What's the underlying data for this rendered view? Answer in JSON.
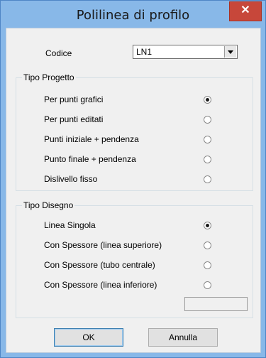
{
  "window": {
    "title": "Polilinea di profilo",
    "close_label": "✕"
  },
  "codice": {
    "label": "Codice",
    "value": "LN1"
  },
  "tipo_progetto": {
    "title": "Tipo Progetto",
    "options": [
      {
        "label": "Per punti grafici",
        "checked": true
      },
      {
        "label": "Per punti editati",
        "checked": false
      },
      {
        "label": "Punti iniziale + pendenza",
        "checked": false
      },
      {
        "label": "Punto finale + pendenza",
        "checked": false
      },
      {
        "label": "Dislivello fisso",
        "checked": false
      }
    ]
  },
  "tipo_disegno": {
    "title": "Tipo Disegno",
    "options": [
      {
        "label": "Linea Singola",
        "checked": true
      },
      {
        "label": "Con Spessore (linea superiore)",
        "checked": false
      },
      {
        "label": "Con Spessore (tubo centrale)",
        "checked": false
      },
      {
        "label": "Con Spessore (linea inferiore)",
        "checked": false
      }
    ],
    "spessore_value": ""
  },
  "buttons": {
    "ok": "OK",
    "cancel": "Annulla"
  }
}
